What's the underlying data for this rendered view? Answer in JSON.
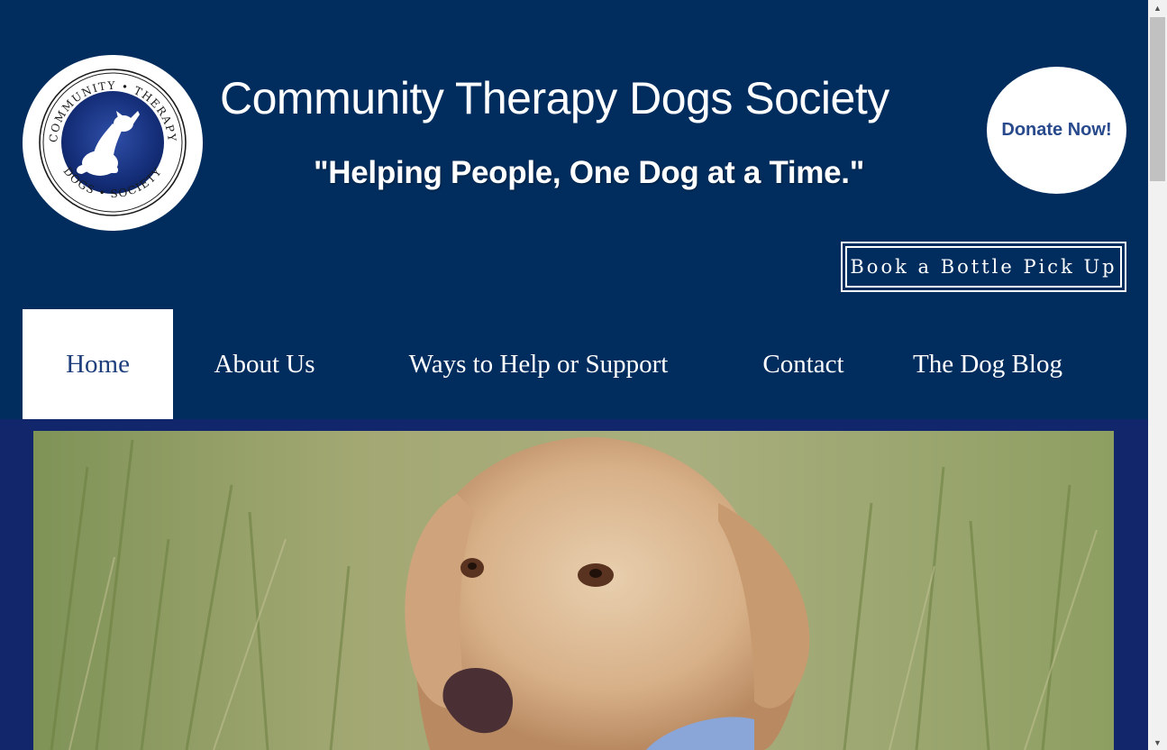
{
  "header": {
    "logo": {
      "top_text": "COMMUNITY • THERAPY",
      "bottom_text": "DOGS • SOCIETY"
    },
    "site_title": "Community Therapy Dogs Society",
    "tagline": "\"Helping People, One Dog at a Time.\"",
    "donate_label": "Donate Now!",
    "book_label": "Book a Bottle Pick Up"
  },
  "nav": {
    "items": [
      {
        "label": "Home",
        "active": true
      },
      {
        "label": "About Us",
        "active": false
      },
      {
        "label": "Ways to Help or Support",
        "active": false
      },
      {
        "label": "Contact",
        "active": false
      },
      {
        "label": "The Dog Blog",
        "active": false
      }
    ]
  },
  "colors": {
    "header_bg": "#002d5e",
    "hero_bg": "#11266b",
    "active_nav_text": "#1e3f7c",
    "donate_text": "#284a8c"
  },
  "hero": {
    "image": "dog-photo"
  },
  "scrollbar": {
    "up_icon": "arrow-up-icon",
    "down_icon": "arrow-down-icon"
  }
}
